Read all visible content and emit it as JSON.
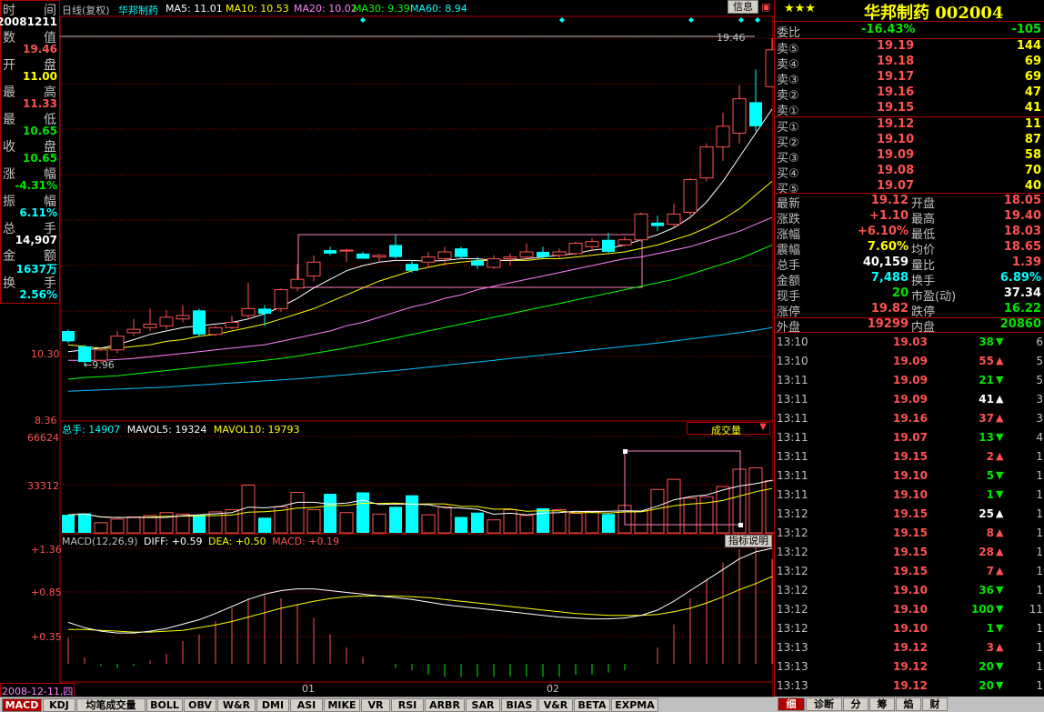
{
  "header": {
    "period": "日线(复权)",
    "stock": "华邦制药",
    "ma5": "MA5: 11.01",
    "ma10": "MA10: 10.53",
    "ma20": "MA20: 10.02",
    "ma30": "MA30: 9.39",
    "ma60": "MA60: 8.94",
    "info_button": "信息"
  },
  "left_panel": {
    "time_label": [
      "时",
      "间"
    ],
    "date": "20081211",
    "rows": [
      {
        "label": [
          "数",
          "值"
        ],
        "value": "19.46",
        "color": "red"
      },
      {
        "label": [
          "开",
          "盘"
        ],
        "value": "11.00",
        "color": "yellow"
      },
      {
        "label": [
          "最",
          "高"
        ],
        "value": "11.33",
        "color": "red"
      },
      {
        "label": [
          "最",
          "低"
        ],
        "value": "10.65",
        "color": "green"
      },
      {
        "label": [
          "收",
          "盘"
        ],
        "value": "10.65",
        "color": "green"
      },
      {
        "label": [
          "涨",
          "幅"
        ],
        "value": "-4.31%",
        "color": "green"
      },
      {
        "label": [
          "振",
          "幅"
        ],
        "value": "6.11%",
        "color": "cyan"
      },
      {
        "label": [
          "总",
          "手"
        ],
        "value": "14,907",
        "color": "white"
      },
      {
        "label": [
          "金",
          "额"
        ],
        "value": "1637万",
        "color": "cyan"
      },
      {
        "label": [
          "换",
          "手"
        ],
        "value": "2.56%",
        "color": "cyan"
      }
    ]
  },
  "price_axis": {
    "p1": "10.30",
    "p2": "8.36",
    "high_marker": "19.46",
    "low_marker": "9.96"
  },
  "volume_panel": {
    "title": "总手: 14907",
    "mavol5": "MAVOL5: 19324",
    "mavol10": "MAVOL10: 19793",
    "dropdown": "成交量",
    "axis_top": "66624",
    "axis_mid": "33312"
  },
  "macd_panel": {
    "title": "MACD(12,26,9)",
    "diff": "DIFF: +0.59",
    "dea": "DEA: +0.50",
    "macd": "MACD: +0.19",
    "explain_button": "指标说明",
    "axis": [
      "+1.36",
      "+0.85",
      "+0.35"
    ]
  },
  "x_axis": {
    "date": "2008-12-11,四",
    "m1": "01",
    "m2": "02"
  },
  "bottom_tabs": [
    "MACD",
    "KDJ",
    "均笔成交量",
    "BOLL",
    "OBV",
    "W&R",
    "DMI",
    "ASI",
    "MIKE",
    "VR",
    "RSI",
    "ARBR",
    "SAR",
    "BIAS",
    "V&R",
    "BETA",
    "EXPMA"
  ],
  "right_tabs": [
    "细",
    "诊断",
    "分",
    "筹",
    "焰",
    "财"
  ],
  "quote": {
    "title": "华邦制药 002004",
    "stars": "★★★",
    "weibi_label": "委比",
    "weibi_pct": "-16.43%",
    "weibi_diff": "-105",
    "sells": [
      {
        "label": "卖⑤",
        "price": "19.19",
        "vol": "144"
      },
      {
        "label": "卖④",
        "price": "19.18",
        "vol": "69"
      },
      {
        "label": "卖③",
        "price": "19.17",
        "vol": "69"
      },
      {
        "label": "卖②",
        "price": "19.16",
        "vol": "47"
      },
      {
        "label": "卖①",
        "price": "19.15",
        "vol": "41"
      }
    ],
    "buys": [
      {
        "label": "买①",
        "price": "19.12",
        "vol": "11"
      },
      {
        "label": "买②",
        "price": "19.10",
        "vol": "87"
      },
      {
        "label": "买③",
        "price": "19.09",
        "vol": "58"
      },
      {
        "label": "买④",
        "price": "19.08",
        "vol": "70"
      },
      {
        "label": "买⑤",
        "price": "19.07",
        "vol": "40"
      }
    ],
    "stats": [
      {
        "l1": "最新",
        "v1": "19.12",
        "c1": "red",
        "l2": "开盘",
        "v2": "18.05",
        "c2": "red"
      },
      {
        "l1": "涨跌",
        "v1": "+1.10",
        "c1": "red",
        "l2": "最高",
        "v2": "19.40",
        "c2": "red"
      },
      {
        "l1": "涨幅",
        "v1": "+6.10%",
        "c1": "red",
        "l2": "最低",
        "v2": "18.03",
        "c2": "red"
      },
      {
        "l1": "震幅",
        "v1": "7.60%",
        "c1": "yellow",
        "l2": "均价",
        "v2": "18.65",
        "c2": "red"
      },
      {
        "l1": "总手",
        "v1": "40,159",
        "c1": "white",
        "l2": "量比",
        "v2": "1.39",
        "c2": "red"
      },
      {
        "l1": "金额",
        "v1": "7,488",
        "c1": "cyan",
        "l2": "换手",
        "v2": "6.89%",
        "c2": "cyan"
      },
      {
        "l1": "现手",
        "v1": "20",
        "c1": "green",
        "l2": "市盈(动)",
        "v2": "37.34",
        "c2": "white"
      },
      {
        "l1": "涨停",
        "v1": "19.82",
        "c1": "red",
        "l2": "跌停",
        "v2": "16.22",
        "c2": "green"
      },
      {
        "l1": "外盘",
        "v1": "19299",
        "c1": "red",
        "l2": "内盘",
        "v2": "20860",
        "c2": "green"
      }
    ]
  },
  "ticks": [
    {
      "time": "13:10",
      "price": "19.03",
      "vol": "38",
      "dir": "down",
      "n": "6"
    },
    {
      "time": "13:10",
      "price": "19.09",
      "vol": "55",
      "dir": "up",
      "n": "5"
    },
    {
      "time": "13:11",
      "price": "19.09",
      "vol": "21",
      "dir": "down",
      "n": "5"
    },
    {
      "time": "13:11",
      "price": "19.09",
      "vol": "41",
      "dir": "upw",
      "n": "3"
    },
    {
      "time": "13:11",
      "price": "19.16",
      "vol": "37",
      "dir": "up",
      "n": "3"
    },
    {
      "time": "13:11",
      "price": "19.07",
      "vol": "13",
      "dir": "down",
      "n": "4"
    },
    {
      "time": "13:11",
      "price": "19.15",
      "vol": "2",
      "dir": "up",
      "n": "1"
    },
    {
      "time": "13:11",
      "price": "19.10",
      "vol": "5",
      "dir": "down",
      "n": "1"
    },
    {
      "time": "13:11",
      "price": "19.10",
      "vol": "1",
      "dir": "down",
      "n": "1"
    },
    {
      "time": "13:12",
      "price": "19.15",
      "vol": "25",
      "dir": "upw",
      "n": "1"
    },
    {
      "time": "13:12",
      "price": "19.15",
      "vol": "8",
      "dir": "up",
      "n": "1"
    },
    {
      "time": "13:12",
      "price": "19.15",
      "vol": "28",
      "dir": "up",
      "n": "1"
    },
    {
      "time": "13:12",
      "price": "19.15",
      "vol": "7",
      "dir": "up",
      "n": "1"
    },
    {
      "time": "13:12",
      "price": "19.10",
      "vol": "36",
      "dir": "down",
      "n": "1"
    },
    {
      "time": "13:12",
      "price": "19.10",
      "vol": "100",
      "dir": "down",
      "n": "11"
    },
    {
      "time": "13:12",
      "price": "19.10",
      "vol": "1",
      "dir": "down",
      "n": "1"
    },
    {
      "time": "13:13",
      "price": "19.12",
      "vol": "3",
      "dir": "up",
      "n": "1"
    },
    {
      "time": "13:13",
      "price": "19.12",
      "vol": "20",
      "dir": "down",
      "n": "1"
    },
    {
      "time": "13:13",
      "price": "19.12",
      "vol": "20",
      "dir": "down",
      "n": "1"
    }
  ],
  "chart_data": {
    "type": "candlestick",
    "candles": [
      {
        "o": 10.95,
        "h": 11.0,
        "l": 10.6,
        "c": 10.65,
        "up": false
      },
      {
        "o": 10.5,
        "h": 10.55,
        "l": 9.96,
        "c": 10.05,
        "up": false
      },
      {
        "o": 10.1,
        "h": 10.45,
        "l": 10.0,
        "c": 10.4,
        "up": true
      },
      {
        "o": 10.4,
        "h": 10.95,
        "l": 10.3,
        "c": 10.8,
        "up": true
      },
      {
        "o": 10.9,
        "h": 11.3,
        "l": 10.8,
        "c": 11.0,
        "up": true
      },
      {
        "o": 11.05,
        "h": 11.6,
        "l": 10.95,
        "c": 11.15,
        "up": true
      },
      {
        "o": 11.1,
        "h": 11.55,
        "l": 11.0,
        "c": 11.35,
        "up": true
      },
      {
        "o": 11.3,
        "h": 11.7,
        "l": 11.2,
        "c": 11.4,
        "up": true
      },
      {
        "o": 11.55,
        "h": 11.6,
        "l": 10.8,
        "c": 10.85,
        "up": false
      },
      {
        "o": 10.85,
        "h": 11.1,
        "l": 10.8,
        "c": 11.05,
        "up": true
      },
      {
        "o": 11.05,
        "h": 11.4,
        "l": 11.0,
        "c": 11.2,
        "up": true
      },
      {
        "o": 11.4,
        "h": 12.35,
        "l": 11.3,
        "c": 11.6,
        "up": true
      },
      {
        "o": 11.6,
        "h": 11.7,
        "l": 11.1,
        "c": 11.45,
        "up": false
      },
      {
        "o": 11.6,
        "h": 12.2,
        "l": 11.5,
        "c": 12.15,
        "up": true
      },
      {
        "o": 12.2,
        "h": 12.9,
        "l": 12.1,
        "c": 12.45,
        "up": true
      },
      {
        "o": 12.55,
        "h": 13.15,
        "l": 12.4,
        "c": 12.95,
        "up": true
      },
      {
        "o": 13.3,
        "h": 13.4,
        "l": 13.15,
        "c": 13.2,
        "up": false
      },
      {
        "o": 13.3,
        "h": 13.35,
        "l": 12.95,
        "c": 13.3,
        "up": true
      },
      {
        "o": 13.2,
        "h": 13.25,
        "l": 13.05,
        "c": 13.05,
        "up": false
      },
      {
        "o": 13.1,
        "h": 13.2,
        "l": 12.95,
        "c": 13.15,
        "up": true
      },
      {
        "o": 13.45,
        "h": 13.75,
        "l": 13.05,
        "c": 13.1,
        "up": false
      },
      {
        "o": 12.9,
        "h": 13.0,
        "l": 12.65,
        "c": 12.7,
        "up": false
      },
      {
        "o": 12.95,
        "h": 13.25,
        "l": 12.8,
        "c": 13.1,
        "up": true
      },
      {
        "o": 13.05,
        "h": 13.4,
        "l": 12.85,
        "c": 13.25,
        "up": true
      },
      {
        "o": 13.35,
        "h": 13.4,
        "l": 13.05,
        "c": 13.1,
        "up": false
      },
      {
        "o": 13.0,
        "h": 13.1,
        "l": 12.75,
        "c": 12.85,
        "up": false
      },
      {
        "o": 12.8,
        "h": 13.15,
        "l": 12.75,
        "c": 13.05,
        "up": true
      },
      {
        "o": 13.05,
        "h": 13.2,
        "l": 12.85,
        "c": 13.1,
        "up": true
      },
      {
        "o": 13.1,
        "h": 13.5,
        "l": 13.0,
        "c": 13.25,
        "up": true
      },
      {
        "o": 13.25,
        "h": 13.4,
        "l": 13.05,
        "c": 13.1,
        "up": false
      },
      {
        "o": 13.15,
        "h": 13.35,
        "l": 13.05,
        "c": 13.25,
        "up": true
      },
      {
        "o": 13.2,
        "h": 13.55,
        "l": 13.15,
        "c": 13.5,
        "up": true
      },
      {
        "o": 13.4,
        "h": 13.65,
        "l": 13.3,
        "c": 13.55,
        "up": true
      },
      {
        "o": 13.6,
        "h": 13.8,
        "l": 13.2,
        "c": 13.25,
        "up": false
      },
      {
        "o": 13.45,
        "h": 13.7,
        "l": 13.4,
        "c": 13.6,
        "up": true
      },
      {
        "o": 13.6,
        "h": 14.4,
        "l": 13.55,
        "c": 14.35,
        "up": true
      },
      {
        "o": 14.1,
        "h": 14.3,
        "l": 13.85,
        "c": 14.0,
        "up": true
      },
      {
        "o": 14.05,
        "h": 14.65,
        "l": 13.95,
        "c": 14.35,
        "up": true
      },
      {
        "o": 14.4,
        "h": 15.4,
        "l": 14.3,
        "c": 15.35,
        "up": true
      },
      {
        "o": 15.4,
        "h": 16.4,
        "l": 15.3,
        "c": 16.3,
        "up": true
      },
      {
        "o": 16.3,
        "h": 17.3,
        "l": 15.9,
        "c": 16.9,
        "up": true
      },
      {
        "o": 16.7,
        "h": 18.1,
        "l": 16.4,
        "c": 17.7,
        "up": true
      },
      {
        "o": 17.6,
        "h": 18.55,
        "l": 16.75,
        "c": 16.9,
        "up": true
      },
      {
        "o": 18.05,
        "h": 19.46,
        "l": 18.03,
        "c": 19.12,
        "up": true
      }
    ],
    "volumes": [
      12500,
      13500,
      7000,
      9500,
      11000,
      12000,
      14000,
      13000,
      12500,
      14500,
      16000,
      33000,
      10500,
      18000,
      28000,
      16000,
      27000,
      14000,
      28000,
      13000,
      18000,
      26000,
      12500,
      18000,
      11000,
      14000,
      9000,
      16000,
      12000,
      17000,
      16000,
      13500,
      15000,
      13000,
      19000,
      15000,
      30000,
      37000,
      24000,
      25000,
      32000,
      44000,
      45000,
      36000
    ],
    "up_flags": [
      false,
      false,
      true,
      true,
      true,
      true,
      true,
      true,
      false,
      true,
      true,
      true,
      false,
      true,
      true,
      true,
      false,
      true,
      false,
      true,
      false,
      false,
      true,
      true,
      false,
      false,
      true,
      true,
      true,
      false,
      true,
      true,
      true,
      false,
      true,
      true,
      true,
      true,
      true,
      true,
      true,
      true,
      true,
      true
    ],
    "ma5": [
      10.35,
      10.4,
      10.45,
      10.55,
      10.7,
      10.85,
      10.95,
      11.05,
      11.1,
      11.15,
      11.2,
      11.3,
      11.45,
      11.65,
      11.9,
      12.2,
      12.45,
      12.7,
      12.85,
      12.95,
      13.0,
      13.0,
      12.98,
      13.0,
      13.05,
      13.05,
      13.0,
      13.0,
      13.05,
      13.1,
      13.15,
      13.2,
      13.3,
      13.35,
      13.45,
      13.6,
      13.75,
      13.95,
      14.25,
      14.7,
      15.3,
      16.0,
      16.7,
      17.4
    ],
    "ma10": [
      10.55,
      10.5,
      10.45,
      10.45,
      10.5,
      10.55,
      10.65,
      10.7,
      10.8,
      10.85,
      10.95,
      11.05,
      11.15,
      11.3,
      11.45,
      11.6,
      11.8,
      12.0,
      12.2,
      12.4,
      12.55,
      12.7,
      12.8,
      12.9,
      12.95,
      13.0,
      13.0,
      13.0,
      13.0,
      13.05,
      13.05,
      13.1,
      13.15,
      13.2,
      13.25,
      13.35,
      13.45,
      13.6,
      13.75,
      13.95,
      14.2,
      14.5,
      14.9,
      15.3
    ],
    "ma20": [
      10.1,
      10.1,
      10.1,
      10.12,
      10.15,
      10.2,
      10.25,
      10.3,
      10.35,
      10.4,
      10.45,
      10.5,
      10.55,
      10.65,
      10.75,
      10.85,
      10.95,
      11.1,
      11.2,
      11.35,
      11.5,
      11.65,
      11.75,
      11.9,
      12.0,
      12.15,
      12.25,
      12.35,
      12.45,
      12.55,
      12.65,
      12.75,
      12.85,
      12.95,
      13.05,
      13.1,
      13.2,
      13.3,
      13.4,
      13.55,
      13.7,
      13.85,
      14.05,
      14.25
    ],
    "ma30": [
      9.55,
      9.6,
      9.62,
      9.65,
      9.7,
      9.75,
      9.8,
      9.85,
      9.9,
      9.95,
      10.0,
      10.05,
      10.1,
      10.15,
      10.22,
      10.3,
      10.38,
      10.46,
      10.55,
      10.65,
      10.75,
      10.85,
      10.95,
      11.05,
      11.15,
      11.25,
      11.35,
      11.45,
      11.55,
      11.65,
      11.75,
      11.85,
      11.95,
      12.05,
      12.15,
      12.25,
      12.35,
      12.45,
      12.6,
      12.75,
      12.9,
      13.05,
      13.25,
      13.45
    ],
    "ma60": [
      9.2,
      9.22,
      9.24,
      9.26,
      9.28,
      9.3,
      9.32,
      9.35,
      9.38,
      9.41,
      9.44,
      9.47,
      9.5,
      9.53,
      9.56,
      9.6,
      9.64,
      9.68,
      9.72,
      9.76,
      9.8,
      9.85,
      9.9,
      9.95,
      10.0,
      10.05,
      10.1,
      10.15,
      10.2,
      10.25,
      10.3,
      10.35,
      10.4,
      10.45,
      10.5,
      10.55,
      10.6,
      10.66,
      10.72,
      10.78,
      10.84,
      10.9,
      10.97,
      11.05
    ],
    "diff": [
      0.52,
      0.46,
      0.42,
      0.4,
      0.4,
      0.42,
      0.45,
      0.5,
      0.55,
      0.62,
      0.7,
      0.78,
      0.84,
      0.88,
      0.9,
      0.9,
      0.88,
      0.86,
      0.84,
      0.82,
      0.8,
      0.78,
      0.75,
      0.72,
      0.7,
      0.68,
      0.66,
      0.64,
      0.62,
      0.6,
      0.58,
      0.57,
      0.56,
      0.56,
      0.57,
      0.6,
      0.66,
      0.76,
      0.88,
      1.0,
      1.12,
      1.24,
      1.32,
      1.36
    ],
    "dea": [
      0.44,
      0.44,
      0.43,
      0.42,
      0.41,
      0.41,
      0.42,
      0.43,
      0.46,
      0.49,
      0.53,
      0.58,
      0.63,
      0.68,
      0.72,
      0.76,
      0.79,
      0.81,
      0.82,
      0.82,
      0.82,
      0.81,
      0.8,
      0.78,
      0.76,
      0.74,
      0.72,
      0.7,
      0.68,
      0.66,
      0.64,
      0.62,
      0.61,
      0.6,
      0.6,
      0.6,
      0.61,
      0.64,
      0.68,
      0.74,
      0.81,
      0.89,
      0.96,
      1.04
    ],
    "price_range": [
      8.36,
      19.46
    ],
    "volume_max": 66624,
    "macd_range": [
      0.05,
      1.36
    ]
  }
}
